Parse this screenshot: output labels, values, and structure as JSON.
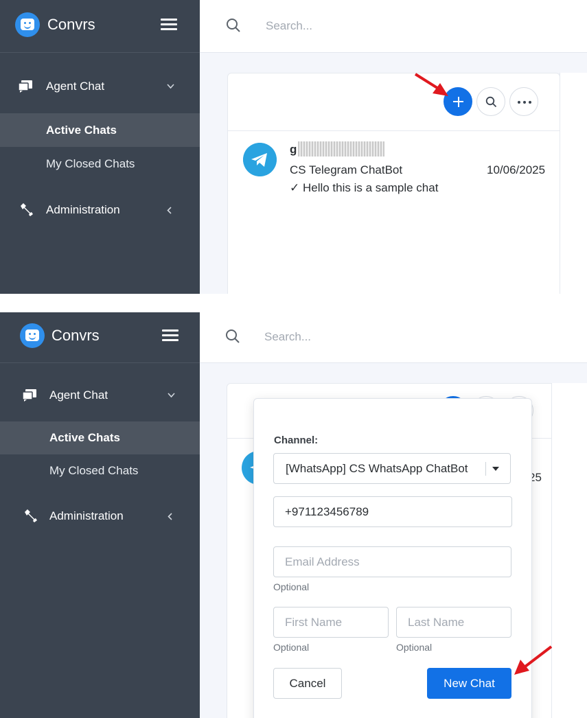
{
  "app": {
    "name": "Convrs"
  },
  "search": {
    "placeholder": "Search..."
  },
  "sidebar": {
    "agent_chat": "Agent Chat",
    "active_chats": "Active Chats",
    "closed_chats": "My Closed Chats",
    "administration": "Administration"
  },
  "chat": {
    "name_initial": "g",
    "channel": "CS Telegram ChatBot",
    "date": "10/06/2025",
    "message": "✓ Hello this is a sample chat",
    "partial_date": "25"
  },
  "new_chat_form": {
    "channel_label": "Channel:",
    "channel_value": "[WhatsApp] CS WhatsApp ChatBot",
    "phone_value": "+971123456789",
    "email_placeholder": "Email Address",
    "first_name_placeholder": "First Name",
    "last_name_placeholder": "Last Name",
    "optional_hint": "Optional",
    "cancel_label": "Cancel",
    "submit_label": "New Chat"
  },
  "colors": {
    "sidebar_bg": "#3b4450",
    "accent": "#1271e6",
    "annotation_arrow": "#e0191f"
  },
  "icons": [
    "menu-icon",
    "search-icon",
    "chat-icon",
    "wrench-icon",
    "plus-icon",
    "more-icon",
    "telegram-icon",
    "chevron-down-icon"
  ]
}
